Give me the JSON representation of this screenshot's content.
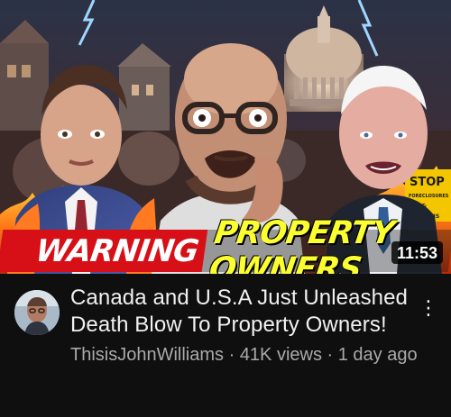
{
  "thumbnail": {
    "warning_text": "WARNING",
    "property_owners_text": "PROPERTY OWNERS",
    "protest_sign_text": "STOP FORECLOSURES & EVICTIONS",
    "duration": "11:53",
    "colors": {
      "banner_red": "#d70f17",
      "banner_yellow": "#fbff2f"
    }
  },
  "video": {
    "title": "Canada and U.S.A Just Unleashed Death Blow To Property Owners!",
    "channel": "ThisisJohnWilliams",
    "separator_1": " · ",
    "views": "41K views",
    "separator_2": " · ",
    "uploaded": "1 day ago"
  },
  "icons": {
    "menu": "more-vert-icon",
    "avatar": "channel-avatar"
  }
}
